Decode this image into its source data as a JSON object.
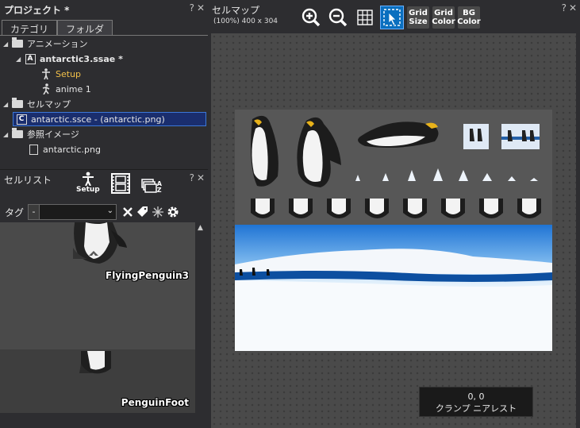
{
  "project": {
    "title": "プロジェクト *",
    "controls": [
      "?",
      "✕"
    ],
    "tabs": [
      "カテゴリ",
      "フォルダ"
    ],
    "tree": [
      {
        "label": "アニメーション",
        "icon": "folder-icon"
      },
      {
        "label": "antarctic3.ssae *",
        "icon": "animation-file-icon"
      },
      {
        "label": "Setup",
        "icon": "setup-figure-icon"
      },
      {
        "label": "anime 1",
        "icon": "anime-figure-icon"
      },
      {
        "label": "セルマップ",
        "icon": "folder-icon"
      },
      {
        "label": "antarctic.ssce - (antarctic.png)",
        "icon": "cellmap-file-icon"
      },
      {
        "label": "参照イメージ",
        "icon": "folder-icon"
      },
      {
        "label": "antarctic.png",
        "icon": "image-file-icon"
      }
    ]
  },
  "celllist": {
    "title": "セルリスト",
    "controls": [
      "?",
      "✕"
    ],
    "setup_label": "Setup",
    "tag_label": "タグ",
    "tag_value": "-",
    "sort_sub": "A",
    "sort_sub2": "Z",
    "cells": [
      {
        "name": "FlyingPenguin3"
      },
      {
        "name": "PenguinFoot"
      }
    ]
  },
  "cellmap": {
    "title": "セルマップ",
    "info": "(100%) 400 x 304",
    "controls": [
      "?",
      "✕"
    ],
    "tools": {
      "grid_size": [
        "Grid",
        "Size"
      ],
      "grid_color": [
        "Grid",
        "Color"
      ],
      "bg_color": [
        "BG",
        "Color"
      ]
    },
    "status_coords": "0, 0",
    "status_mode": "クランプ ニアレスト"
  },
  "colors": {
    "panel": "#2d2d30",
    "accent": "#0a6fbf",
    "selection": "#1a2e6e",
    "ocean": "#1f74d4"
  }
}
